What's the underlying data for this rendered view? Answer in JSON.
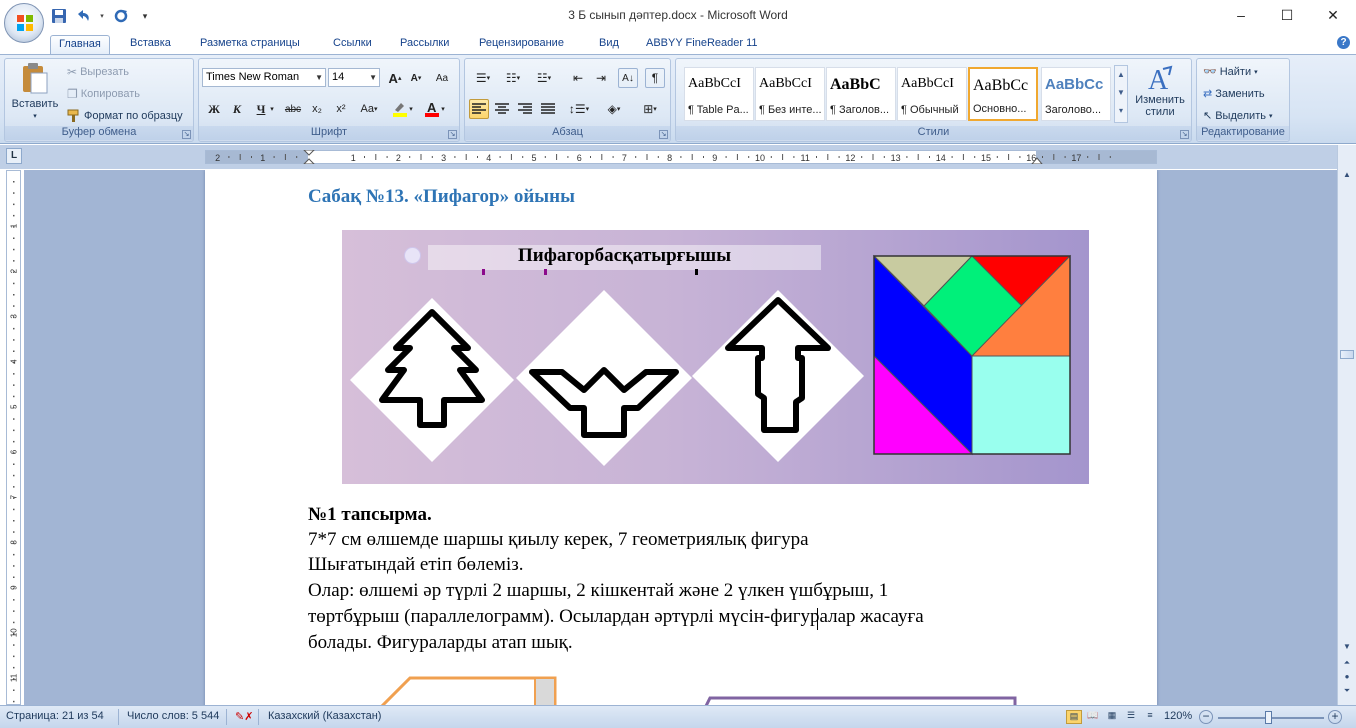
{
  "window": {
    "title": "3 Б сынып дәптер.docx - Microsoft Word",
    "controls": [
      "–",
      "☐",
      "✕"
    ]
  },
  "tabs": [
    {
      "label": "Главная",
      "active": true
    },
    {
      "label": "Вставка"
    },
    {
      "label": "Разметка страницы"
    },
    {
      "label": "Ссылки"
    },
    {
      "label": "Рассылки"
    },
    {
      "label": "Рецензирование"
    },
    {
      "label": "Вид"
    },
    {
      "label": "ABBYY FineReader 11"
    }
  ],
  "ribbon": {
    "clipboard": {
      "label": "Буфер обмена",
      "paste": "Вставить",
      "cut": "Вырезать",
      "copy": "Копировать",
      "format_painter": "Формат по образцу"
    },
    "font": {
      "label": "Шрифт",
      "font_name": "Times New Roman",
      "font_size": "14",
      "bold": "Ж",
      "italic": "К",
      "underline": "Ч",
      "strike": "abc",
      "subscript": "x₂",
      "superscript": "x²",
      "change_case": "Aa",
      "grow": "A",
      "shrink": "A"
    },
    "paragraph": {
      "label": "Абзац"
    },
    "styles": {
      "label": "Стили",
      "items": [
        {
          "preview": "AaBbCcI",
          "name": "¶ Table Pa..."
        },
        {
          "preview": "AaBbCcI",
          "name": "¶ Без инте..."
        },
        {
          "preview": "AaBbC",
          "name": "¶ Заголов..."
        },
        {
          "preview": "AaBbCcI",
          "name": "¶ Обычный"
        },
        {
          "preview": "AaBbCc",
          "name": "Основно..."
        },
        {
          "preview": "AaBbCc",
          "name": "Заголово..."
        }
      ],
      "change_styles": "Изменить стили"
    },
    "editing": {
      "label": "Редактирование",
      "find": "Найти",
      "replace": "Заменить",
      "select": "Выделить"
    }
  },
  "ruler": {
    "numbers": [
      "2",
      "1",
      "1",
      "2",
      "3",
      "4",
      "5",
      "6",
      "7",
      "8",
      "9",
      "10",
      "11",
      "12",
      "13",
      "14",
      "15",
      "16",
      "17"
    ],
    "v_numbers": [
      "1",
      "2",
      "3",
      "4",
      "5",
      "6",
      "7",
      "8",
      "9",
      "10",
      "11"
    ]
  },
  "document": {
    "heading": "Сабақ №13. «Пифагор» ойыны",
    "image_title": "Пифагорбасқатырғышы",
    "task_title": "№1 тапсырма.",
    "paragraphs": [
      "7*7 см өлшемде шаршы қиылу керек, 7 геометриялық фигура",
      "Шығатындай етіп бөлеміз.",
      "Олар: өлшемі әр түрлі 2 шаршы, 2 кішкентай және 2 үлкен үшбұрыш, 1",
      "төртбұрыш (параллелограмм). Осылардан әртүрлі мүсін-фигуралар жасауға",
      "болады. Фигураларды атап шық."
    ]
  },
  "statusbar": {
    "page": "Страница: 21 из 54",
    "words": "Число слов: 5 544",
    "language": "Казахский (Казахстан)",
    "zoom": "120%"
  },
  "colors": {
    "heading": "#2e74b5",
    "ribbon_bg": "#dbe6f4",
    "doc_bg": "#a2b5d4",
    "tangram_blue": "#0000ff",
    "tangram_green": "#00f07a",
    "tangram_red": "#ff0000",
    "tangram_orange": "#ff7f3f",
    "tangram_magenta": "#ff00ff",
    "tangram_cyan": "#99ffee",
    "tangram_beige": "#c8cba0"
  },
  "icons": [
    "office-logo-icon",
    "save-icon",
    "undo-icon",
    "redo-icon",
    "customize-qat-icon",
    "help-icon",
    "paste-icon",
    "scissors-icon",
    "copy-icon",
    "format-painter-icon",
    "bullets-icon",
    "numbering-icon",
    "multilevel-icon",
    "decrease-indent-icon",
    "increase-indent-icon",
    "sort-icon",
    "pilcrow-icon",
    "align-left-icon",
    "align-center-icon",
    "align-right-icon",
    "justify-icon",
    "line-spacing-icon",
    "shading-icon",
    "borders-icon",
    "change-styles-icon",
    "binoculars-icon",
    "replace-icon",
    "select-icon",
    "ruler-toggle-icon",
    "spellcheck-icon"
  ]
}
